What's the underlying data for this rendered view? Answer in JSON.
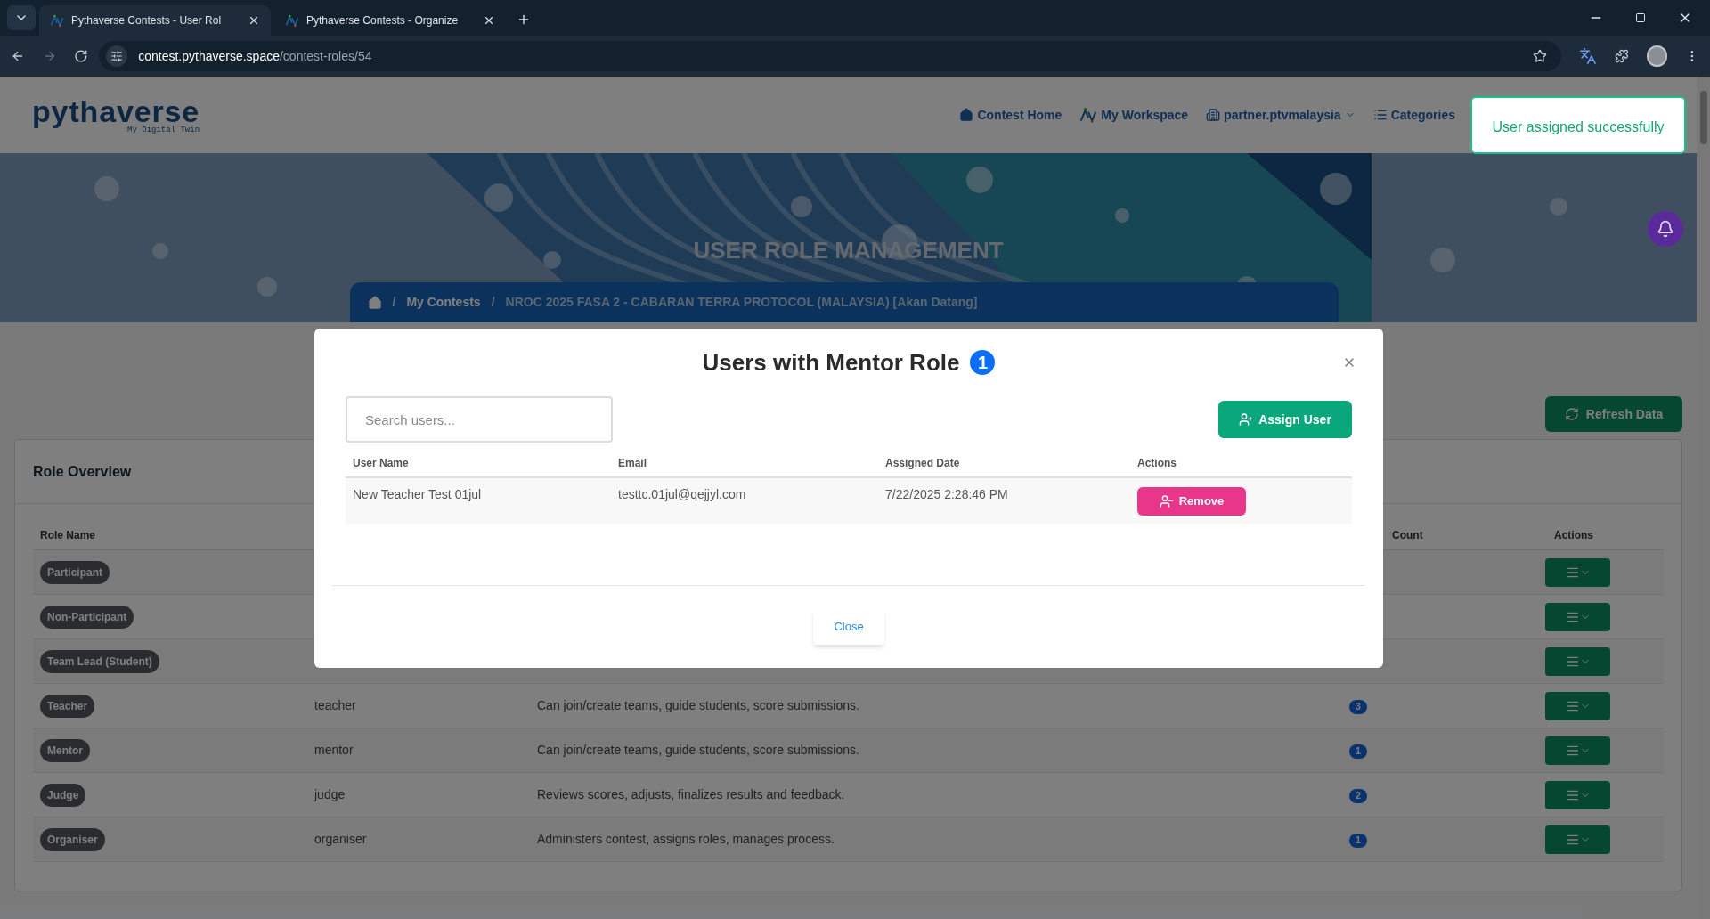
{
  "browser": {
    "tabs": [
      {
        "title": "Pythaverse Contests - User Rol",
        "selected": true
      },
      {
        "title": "Pythaverse Contests - Organize",
        "selected": false
      }
    ],
    "url": {
      "host": "contest.pythaverse.space",
      "path": "/contest-roles/54"
    }
  },
  "header": {
    "logo": {
      "wordmark": "pythaverse",
      "tagline": "My Digital Twin"
    },
    "nav": [
      {
        "label": "Contest Home",
        "kind": "home",
        "dropdown": false
      },
      {
        "label": "My Workspace",
        "kind": "workspace",
        "dropdown": false
      },
      {
        "label": "partner.ptvmalaysia",
        "kind": "account",
        "dropdown": true
      },
      {
        "label": "Categories",
        "kind": "categories",
        "dropdown": false
      }
    ]
  },
  "toast": {
    "message": "User assigned successfully"
  },
  "banner": {
    "title": "USER ROLE MANAGEMENT",
    "breadcrumb_separator": "/",
    "breadcrumb": [
      "My Contests",
      "NROC 2025 FASA 2 - CABARAN TERRA PROTOCOL (MALAYSIA) [Akan Datang]"
    ]
  },
  "refresh_button": "Refresh Data",
  "role_overview": {
    "title": "Role Overview",
    "columns": {
      "role_name": "Role Name",
      "count": "Count",
      "actions": "Actions"
    },
    "rows": [
      {
        "role": "Participant"
      },
      {
        "role": "Non-Participant"
      },
      {
        "role": "Team Lead (Student)"
      },
      {
        "role": "Teacher",
        "key": "teacher",
        "description": "Can join/create teams, guide students, score submissions.",
        "count": "3"
      },
      {
        "role": "Mentor",
        "key": "mentor",
        "description": "Can join/create teams, guide students, score submissions.",
        "count": "1"
      },
      {
        "role": "Judge",
        "key": "judge",
        "description": "Reviews scores, adjusts, finalizes results and feedback.",
        "count": "2"
      },
      {
        "role": "Organiser",
        "key": "organiser",
        "description": "Administers contest, assigns roles, manages process.",
        "count": "1"
      }
    ]
  },
  "modal": {
    "title": "Users with Mentor Role",
    "count": "1",
    "search": {
      "placeholder": "Search users..."
    },
    "assign_button": "Assign User",
    "columns": [
      "User Name",
      "Email",
      "Assigned Date",
      "Actions"
    ],
    "rows": [
      {
        "name": "New Teacher Test 01jul",
        "email": "testtc.01jul@qejjyl.com",
        "date": "7/22/2025 2:28:46 PM",
        "action": "Remove"
      }
    ],
    "close_button": "Close"
  }
}
